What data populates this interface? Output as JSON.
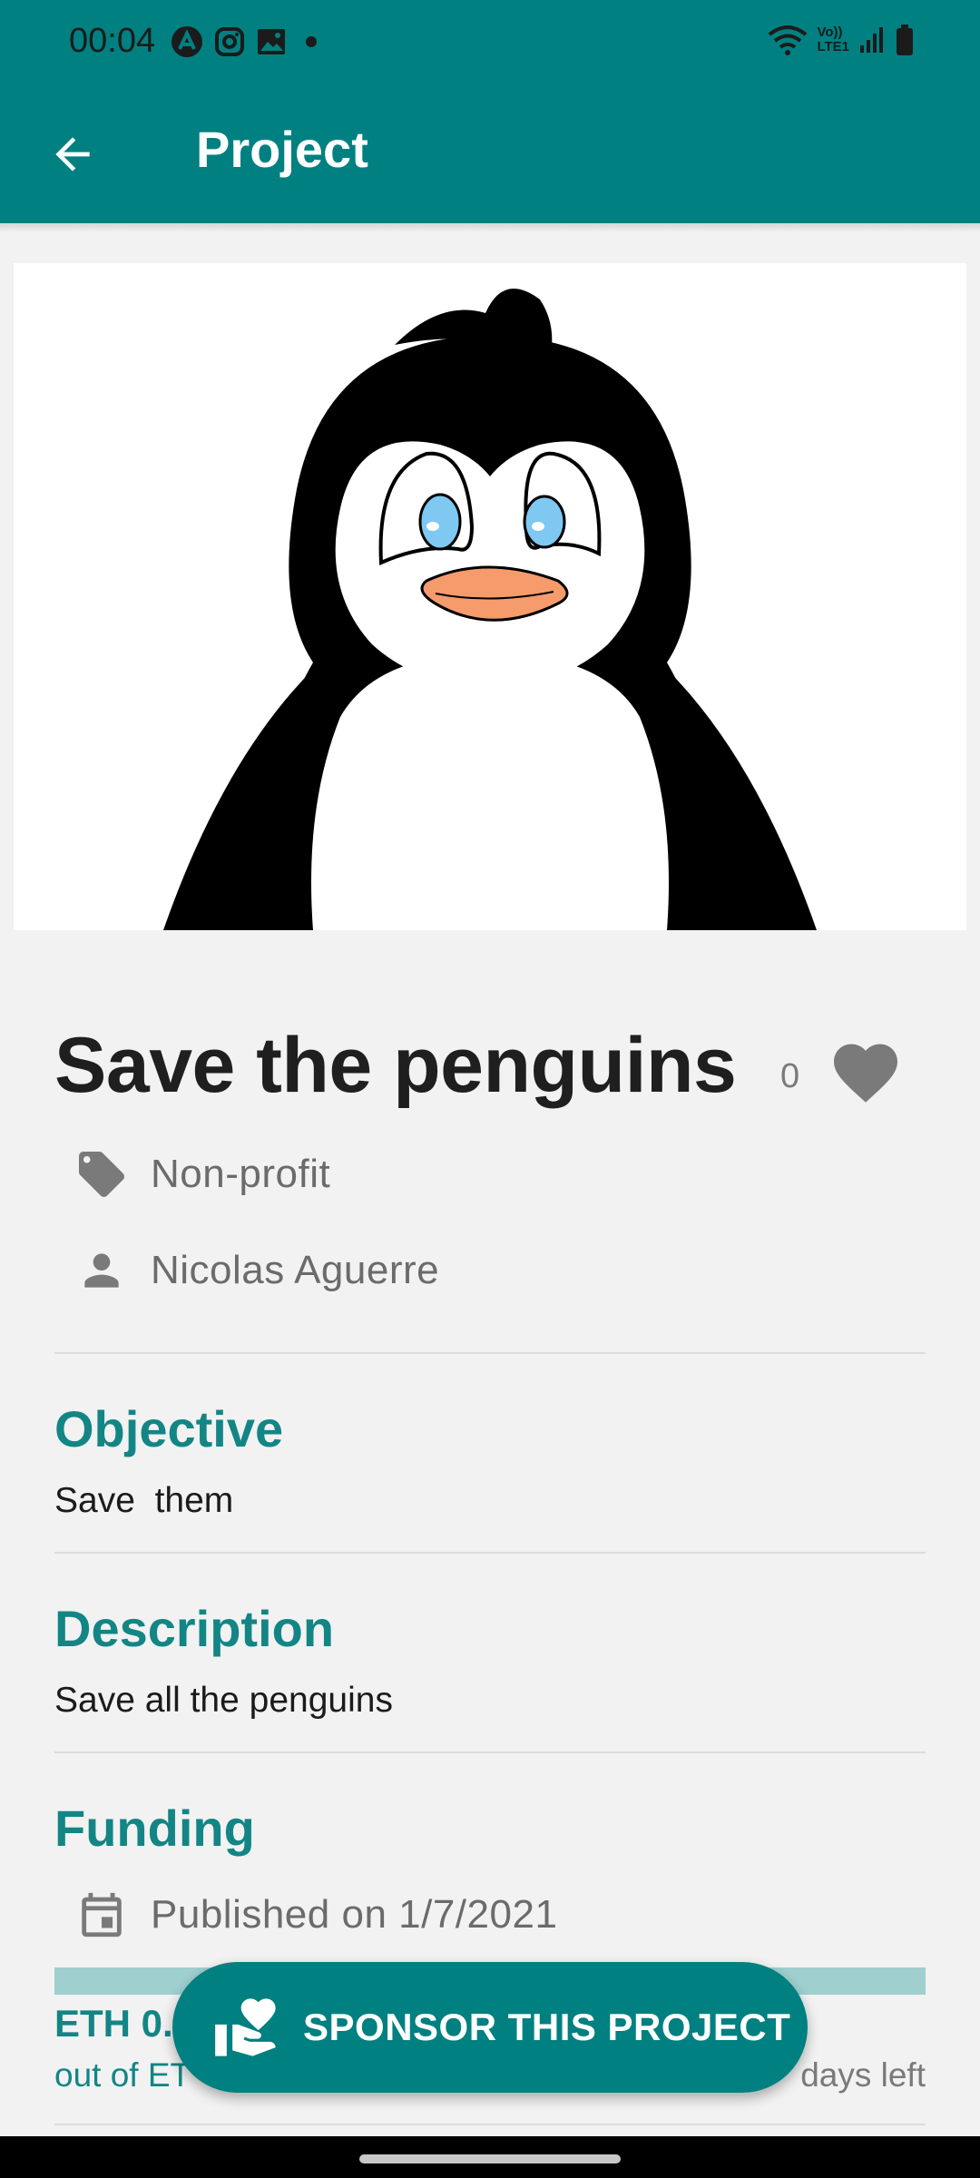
{
  "status_bar": {
    "time": "00:04",
    "left_icons": [
      "app-badge-icon",
      "instagram-icon",
      "gallery-icon",
      "dot-icon"
    ],
    "right_icons": [
      "wifi-icon",
      "volte-icon",
      "signal-icon",
      "battery-icon"
    ],
    "volte_text_top": "Vo))",
    "volte_text_bottom": "LTE1"
  },
  "app_bar": {
    "title": "Project",
    "background": "#008080"
  },
  "project": {
    "title": "Save the penguins",
    "like_count": "0",
    "category": "Non-profit",
    "owner": "Nicolas Aguerre"
  },
  "sections": {
    "objective_title": "Objective",
    "objective_body": "Save  them",
    "description_title": "Description",
    "description_body": "Save all the penguins",
    "funding_title": "Funding"
  },
  "funding": {
    "published": "Published on 1/7/2021",
    "raised_partial": "ETH 0.",
    "goal_partial": "out of ET",
    "days_partial": "days left",
    "progress_fraction": 0.0
  },
  "fab": {
    "label": "SPONSOR THIS PROJECT"
  },
  "colors": {
    "accent": "#008080",
    "section_title": "#138585",
    "progress_track": "#9fcfcf"
  }
}
